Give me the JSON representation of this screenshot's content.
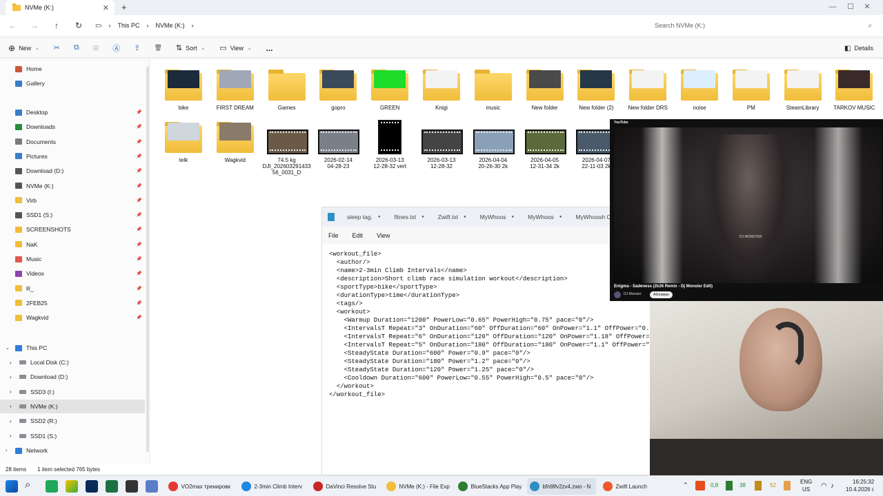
{
  "window": {
    "tab_title": "NVMe (K:)",
    "new_tab": "+"
  },
  "address": {
    "crumbs": [
      "This PC",
      "NVMe (K:)"
    ],
    "search_placeholder": "Search NVMe (K:)"
  },
  "commands": {
    "new": "New",
    "sort": "Sort",
    "view": "View",
    "more": "...",
    "details": "Details"
  },
  "nav": {
    "quick": [
      "Home",
      "Gallery"
    ],
    "pinned": [
      "Desktop",
      "Downloads",
      "Documents",
      "Pictures",
      "Download (D:)",
      "NVMe (K:)",
      "Virb",
      "SSD1 (S:)",
      "SCREENSHOTS",
      "NaK",
      "Music",
      "Videos",
      "R_",
      "2FEB25",
      "Wagkvid"
    ],
    "this_pc": "This PC",
    "drives": [
      "Local Disk (C:)",
      "Download (D:)",
      "SSD3 (I:)",
      "NVMe (K:)",
      "SSD2 (R:)",
      "SSD1 (S:)"
    ],
    "network": "Network"
  },
  "items_row1": [
    "bike",
    "FIRST DREAM",
    "Games",
    "gopro",
    "GREEN",
    "Knigi",
    "music",
    "New folder",
    "New folder (2)",
    "New folder DRS",
    "noise",
    "PM",
    "SteamLibrary",
    "TARKOV MUSIC"
  ],
  "items_row2": [
    {
      "name": "telk",
      "kind": "folder"
    },
    {
      "name": "Wagkvid",
      "kind": "folder"
    },
    {
      "name": "74.5 kg\nDJI_202603291433\n56_0031_D",
      "kind": "video"
    },
    {
      "name": "2026-02-14\n04-28-23",
      "kind": "video"
    },
    {
      "name": "2026-03-13\n12-28-32 vert",
      "kind": "video"
    },
    {
      "name": "2026-03-13\n12-28-32",
      "kind": "video"
    },
    {
      "name": "2026-04-04\n20-26-30 2k",
      "kind": "video"
    },
    {
      "name": "2026-04-05\n12-31-34 2k",
      "kind": "video"
    },
    {
      "name": "2026-04-07\n22-11-03 2k",
      "kind": "video"
    }
  ],
  "status": {
    "count": "28 items",
    "selected": "1 item selected  765 bytes"
  },
  "notepad": {
    "tabs": [
      "sleep tag.",
      "fitnes.txt",
      "Zwift.txt",
      "MyWhoos",
      "MyWhoos",
      "MyWhoosh CE"
    ],
    "menu": [
      "File",
      "Edit",
      "View"
    ],
    "text": "<workout_file>\n  <author/>\n  <name>2-3min Climb Intervals</name>\n  <description>Short climb race simulation workout</description>\n  <sportType>bike</sportType>\n  <durationType>time</durationType>\n  <tags/>\n  <workout>\n    <Warmup Duration=\"1200\" PowerLow=\"0.65\" PowerHigh=\"0.75\" pace=\"0\"/>\n    <IntervalsT Repeat=\"3\" OnDuration=\"60\" OffDuration=\"60\" OnPower=\"1.1\" OffPower=\"0.55\n    <IntervalsT Repeat=\"6\" OnDuration=\"120\" OffDuration=\"120\" OnPower=\"1.18\" OffPower=\"0\n    <IntervalsT Repeat=\"5\" OnDuration=\"180\" OffDuration=\"180\" OnPower=\"1.1\" OffPower=\"0.\n    <SteadyState Duration=\"600\" Power=\"0.9\" pace=\"0\"/>\n    <SteadyState Duration=\"180\" Power=\"1.2\" pace=\"0\"/>\n    <SteadyState Duration=\"120\" Power=\"1.25\" pace=\"0\"/>\n    <Cooldown Duration=\"600\" PowerLow=\"0.55\" PowerHigh=\"0.5\" pace=\"0\"/>\n  </workout>\n</workout_file>"
  },
  "youtube": {
    "logo": "YouTube",
    "title": "Enigma - Sadeness (2k26 Remix - Dj Monster Edit)",
    "channel": "DJ Monster",
    "subscribe": "Абониран",
    "overlay": "DJ MONSTER"
  },
  "taskbar": {
    "apps": [
      "VO2max тренировк",
      "2-3min Climb Interv",
      "DaVinci Resolve Stu",
      "NVMe (K:) - File Exp",
      "BlueStacks App Play",
      "bfn9lfv2zv4.zwo - N",
      "Zwift Launch"
    ],
    "tray": [
      "0,8",
      "38",
      "52"
    ],
    "lang": "ENG",
    "region": "US",
    "time": "16:25:32",
    "date": "10.4.2026 г."
  }
}
